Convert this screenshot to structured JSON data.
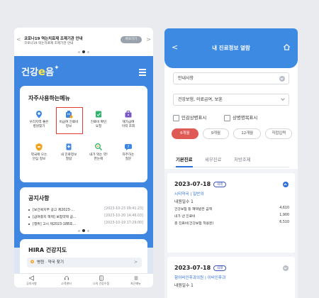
{
  "left": {
    "banner": {
      "title": "코로나19 역는치료제 조제기관 안내",
      "subtitle": "코로나19 먹는치료제 조제기관 안내",
      "button": "바로가기",
      "prev": "<",
      "next": ">"
    },
    "logo": {
      "text1": "건강",
      "text2": "e",
      "text3": "음"
    },
    "favorites": {
      "title": "자주사용하는메뉴",
      "items": [
        {
          "l1": "우리지역 좋은",
          "l2": "병원찾기",
          "icon": "hospital-pin-icon",
          "color": "#3f86e0"
        },
        {
          "l1": "비급여 진료비",
          "l2": "정보",
          "icon": "money-building-icon",
          "color": "#3f86e0",
          "selected": true
        },
        {
          "l1": "진료비 확인",
          "l2": "요청",
          "icon": "receipt-check-icon",
          "color": "#2bb56a"
        },
        {
          "l1": "재가급여",
          "l2": "이력 조회",
          "icon": "briefcase-icon",
          "color": "#7a56c7"
        },
        {
          "l1": "약국에 오는",
          "l2": "안심 정보",
          "icon": "pill-shield-icon",
          "color": "#f2a21d"
        },
        {
          "l1": "내 진료정보",
          "l2": "열람",
          "icon": "medical-record-icon",
          "color": "#3f86e0"
        },
        {
          "l1": "내가 먹는 약!",
          "l2": "한눈에",
          "icon": "pill-search-icon",
          "color": "#2bb56a"
        },
        {
          "l1": "자주하는",
          "l2": "질문",
          "icon": "faq-icon",
          "color": "#3f86e0"
        }
      ]
    },
    "notices": {
      "title": "공지사항",
      "items": [
        {
          "text": "[보건복지부 공고 제2023-…",
          "date": "[2023-10-23 09:41:23]"
        },
        {
          "text": "[급여중지 해제] 보험약제 급…",
          "date": "[2023-10-20 14:46:03]"
        },
        {
          "text": "[행위] 고시 제2023-188호…",
          "date": "[2023-10-19 17:29:00]"
        }
      ]
    },
    "hira": {
      "title": "HIRA 건강지도",
      "item": "병원 · 약국 찾기",
      "chev": ">"
    },
    "tabs": [
      "공지사항",
      "고객센터",
      "나의 건강수첩",
      "최근메뉴"
    ]
  },
  "right": {
    "title": "내 진료정보 열람",
    "back": "<",
    "select1": "안내사항",
    "select2": "건강보험, 의료급여, 보훈",
    "check1": "민감상병표시",
    "check2": "상병명목표시",
    "periods": [
      "6개월",
      "9개월",
      "12개월",
      "직접입력"
    ],
    "tabs": [
      "기본진료",
      "세부진료",
      "처방조제"
    ],
    "records": [
      {
        "date": "2023-07-18",
        "badge": "외래",
        "inst": "시티약국 | 일반의",
        "days": "내원일수 1",
        "rows": [
          {
            "label": "건강보험 등 혜택받은 금액",
            "value": "4,610"
          },
          {
            "label": "내가 낸 진료비",
            "value": "1,900"
          },
          {
            "label": "총 진료비(건강보험 적용분)",
            "value": "6,510"
          }
        ]
      },
      {
        "date": "2023-07-18",
        "badge": "외래",
        "inst": "함어비인후과의원 | 이비인후과",
        "days": "내원일수 1"
      }
    ]
  },
  "colors": {
    "brand_blue": "#3f86e0",
    "accent_red": "#e05a55",
    "link_blue": "#2f6fd9"
  }
}
